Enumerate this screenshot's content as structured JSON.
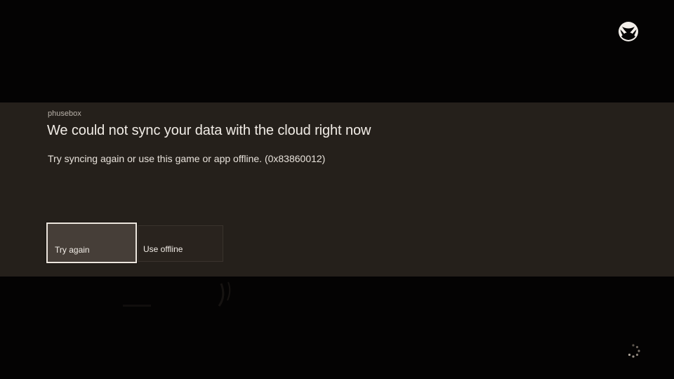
{
  "dialog": {
    "app_name": "phusebox",
    "title": "We could not sync your data with the cloud right now",
    "message": "Try syncing again or use this game or app offline. (0x83860012)",
    "buttons": [
      {
        "label": "Try again",
        "focused": true
      },
      {
        "label": "Use offline",
        "focused": false
      }
    ]
  },
  "icons": {
    "logo": "xbox-logo-icon",
    "loading": "loading-spinner-icon"
  },
  "colors": {
    "background": "#040303",
    "dialog_band": "#25201b",
    "focused_button": "#463e38",
    "focus_border": "#ede6de",
    "text": "#f1ece6"
  }
}
